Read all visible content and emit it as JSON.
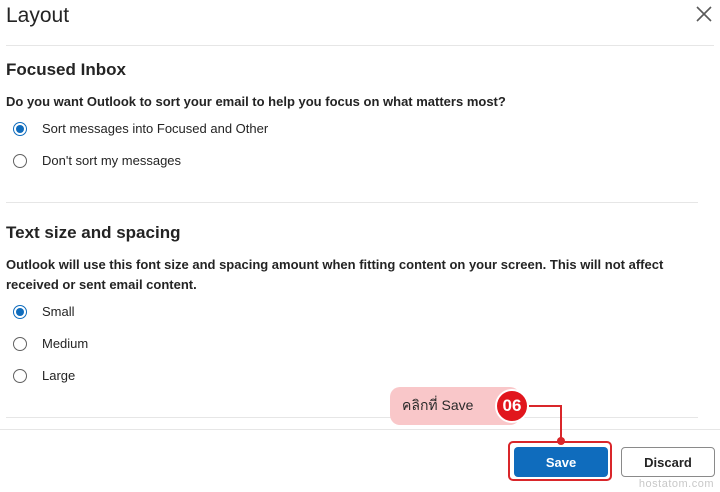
{
  "dialog": {
    "title": "Layout"
  },
  "focused_inbox": {
    "heading": "Focused Inbox",
    "question": "Do you want Outlook to sort your email to help you focus on what matters most?",
    "options": [
      {
        "label": "Sort messages into Focused and Other",
        "selected": true
      },
      {
        "label": "Don't sort my messages",
        "selected": false
      }
    ]
  },
  "text_size": {
    "heading": "Text size and spacing",
    "description": "Outlook will use this font size and spacing amount when fitting content on your screen. This will not affect received or sent email content.",
    "options": [
      {
        "label": "Small",
        "selected": true
      },
      {
        "label": "Medium",
        "selected": false
      },
      {
        "label": "Large",
        "selected": false
      }
    ]
  },
  "footer": {
    "save_label": "Save",
    "discard_label": "Discard"
  },
  "annotation": {
    "callout_text": "คลิกที่ Save",
    "step_number": "06"
  },
  "watermark": "hostatom.com",
  "colors": {
    "accent": "#0f6cbd",
    "annotation_red": "#e1161d",
    "callout_pink": "#f9c7c9"
  },
  "icons": {
    "close": "close-icon"
  }
}
